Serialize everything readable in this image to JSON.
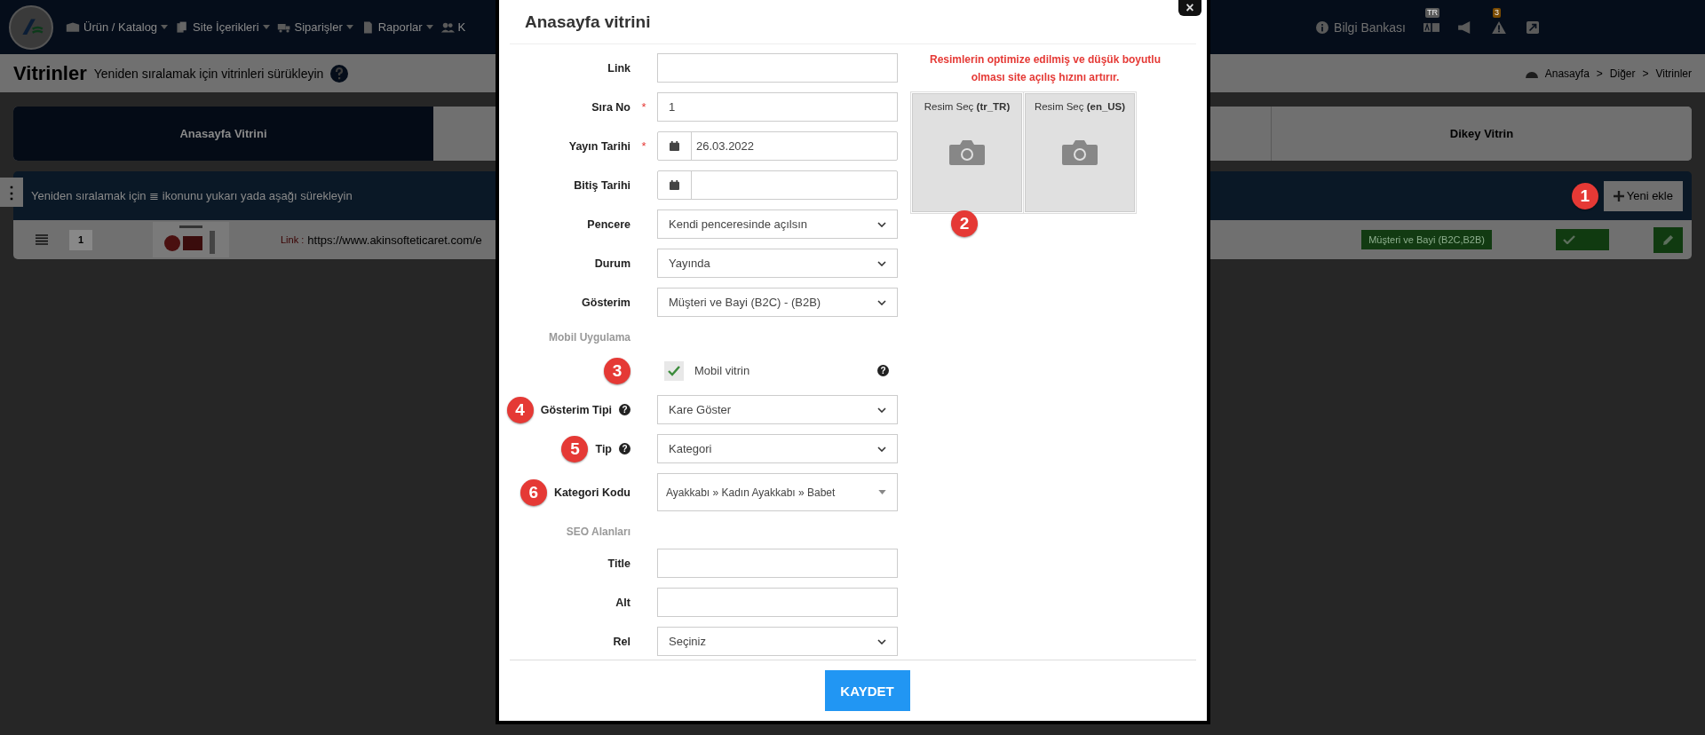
{
  "topbar": {
    "nav": [
      {
        "label": "Ürün / Katalog",
        "dropdown": true
      },
      {
        "label": "Site İçerikleri",
        "dropdown": true
      },
      {
        "label": "Siparişler",
        "dropdown": true
      },
      {
        "label": "Raporlar",
        "dropdown": true
      },
      {
        "label": "K",
        "dropdown": false
      }
    ],
    "knowledge_base": "Bilgi Bankası",
    "language_badge": "TR",
    "alerts_badge": "3"
  },
  "page": {
    "title": "Vitrinler",
    "subtitle": "Yeniden sıralamak için vitrinleri sürükleyin",
    "breadcrumb": [
      {
        "label": "Anasayfa"
      },
      {
        "label": "Diğer",
        "separator": ">"
      },
      {
        "label": "Vitrinler",
        "separator": ">"
      }
    ]
  },
  "tabs": [
    {
      "label": "Anasayfa Vitrini",
      "selected": true
    },
    {
      "label": "Dikey Vitrin",
      "selected": false
    }
  ],
  "list": {
    "handle": "⋮",
    "hint": "Yeniden sıralamak için ≣ ikonunu yukarı yada aşağı sürekleyin",
    "add_button": "Yeni ekle",
    "add_badge": "1",
    "rows": [
      {
        "order": "1",
        "link_label": "Link :",
        "link": "https://www.akinsofteticaret.com/e",
        "audience": "Müşteri ve Bayi (B2C,B2B)",
        "active": true
      }
    ]
  },
  "modal": {
    "title": "Anasayfa vitrini",
    "close": "×",
    "fields": [
      {
        "kind": "text",
        "label": "Link"
      },
      {
        "kind": "text",
        "label": "Sıra No",
        "value": "1",
        "required_mark": "*"
      },
      {
        "kind": "date",
        "label": "Yayın Tarihi",
        "value": "26.03.2022",
        "required_mark": "*"
      },
      {
        "kind": "date",
        "label": "Bitiş Tarihi"
      },
      {
        "kind": "select",
        "label": "Pencere",
        "value": "Kendi penceresinde açılsın"
      },
      {
        "kind": "select",
        "label": "Durum",
        "value": "Yayında"
      },
      {
        "kind": "select",
        "label": "Gösterim",
        "value": "Müşteri ve Bayi (B2C) - (B2B)"
      },
      {
        "kind": "heading",
        "label": "Mobil Uygulama"
      },
      {
        "kind": "checkbox",
        "label": "Mobil vitrin",
        "checked": true,
        "help_icon": "?",
        "badge": "3"
      },
      {
        "kind": "select",
        "label": "Gösterim Tipi",
        "value": "Kare Göster",
        "help_icon": "?",
        "badge": "4"
      },
      {
        "kind": "select",
        "label": "Tip",
        "value": "Kategori",
        "help_icon": "?",
        "badge": "5"
      },
      {
        "kind": "combo",
        "label": "Kategori Kodu",
        "value": "Ayakkabı » Kadın Ayakkabı » Babet",
        "badge": "6"
      },
      {
        "kind": "heading",
        "label": "SEO Alanları"
      },
      {
        "kind": "text",
        "label": "Title"
      },
      {
        "kind": "text",
        "label": "Alt"
      },
      {
        "kind": "select",
        "label": "Rel",
        "value": "Seçiniz"
      }
    ],
    "image_note": "Resimlerin optimize edilmiş ve düşük boyutlu olması site açılış hızını artırır.",
    "images": [
      {
        "label": "Resim Seç **(tr_TR)**"
      },
      {
        "label": "Resim Seç **(en_US)**"
      }
    ],
    "images_badge": "2",
    "save_button": "KAYDET"
  }
}
